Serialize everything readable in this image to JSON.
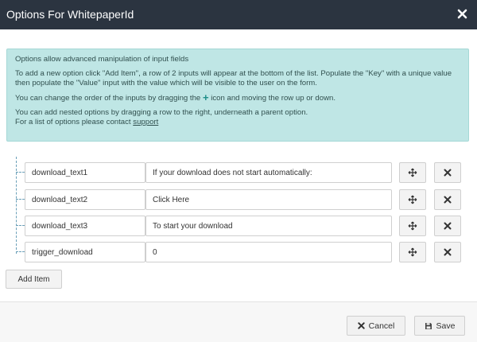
{
  "dialog": {
    "title": "Options For WhitepaperId",
    "close_icon": "close-icon"
  },
  "info": {
    "line1": "Options allow advanced manipulation of input fields",
    "line2": "To add a new option click \"Add Item\", a row of 2 inputs will appear at the bottom of the list. Populate the \"Key\" with a unique value then populate the \"Value\" input with the value which will be visible to the user on the form.",
    "line3_before": "You can change the order of the inputs by dragging the",
    "line3_icon": "+",
    "line3_after": "icon and moving the row up or down.",
    "line4": "You can add nested options by dragging a row to the right, underneath a parent option.",
    "line5_before": "For a list of options please contact",
    "line5_link": "support"
  },
  "options": [
    {
      "key": "download_text1",
      "value": "If your download does not start automatically:"
    },
    {
      "key": "download_text2",
      "value": "Click Here"
    },
    {
      "key": "download_text3",
      "value": "To start your download"
    },
    {
      "key": "trigger_download",
      "value": "0"
    }
  ],
  "add_item_label": "Add Item",
  "footer": {
    "cancel_label": "Cancel",
    "save_label": "Save"
  }
}
